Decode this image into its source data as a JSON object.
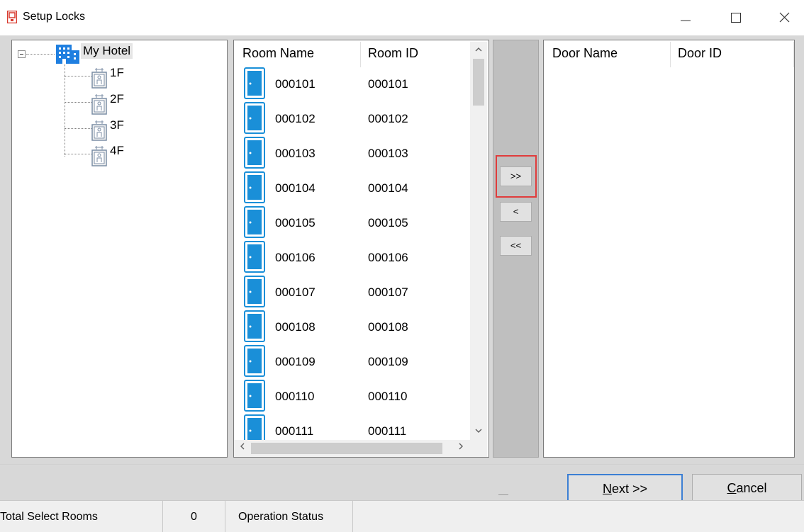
{
  "window": {
    "title": "Setup Locks",
    "controls": {
      "minimize": "—",
      "maximize": "☐",
      "close": "✕"
    }
  },
  "tree": {
    "root_label": "My Hotel",
    "root_icon": "hotel-building-icon",
    "floors": [
      {
        "label": "1F",
        "icon": "elevator-icon"
      },
      {
        "label": "2F",
        "icon": "elevator-icon"
      },
      {
        "label": "3F",
        "icon": "elevator-icon"
      },
      {
        "label": "4F",
        "icon": "elevator-icon"
      }
    ]
  },
  "rooms": {
    "headers": {
      "name": "Room Name",
      "id": "Room ID"
    },
    "items": [
      {
        "name": "000101",
        "id": "000101"
      },
      {
        "name": "000102",
        "id": "000102"
      },
      {
        "name": "000103",
        "id": "000103"
      },
      {
        "name": "000104",
        "id": "000104"
      },
      {
        "name": "000105",
        "id": "000105"
      },
      {
        "name": "000106",
        "id": "000106"
      },
      {
        "name": "000107",
        "id": "000107"
      },
      {
        "name": "000108",
        "id": "000108"
      },
      {
        "name": "000109",
        "id": "000109"
      },
      {
        "name": "000110",
        "id": "000110"
      },
      {
        "name": "000111",
        "id": "000111"
      }
    ],
    "scroll": {
      "up": "^",
      "down": "v",
      "left": "<",
      "right": ">"
    }
  },
  "transfer": {
    "add_all": ">>",
    "remove": "<",
    "remove_all": "<<"
  },
  "doors": {
    "headers": {
      "name": "Door Name",
      "id": "Door ID"
    }
  },
  "buttons": {
    "next": "Next >>",
    "cancel": "Cancel"
  },
  "status": {
    "total_label": "Total Select Rooms",
    "total_value": "0",
    "operation_label": "Operation Status"
  },
  "colors": {
    "room_icon": "#1a8fd8",
    "highlight": "#e03c3c",
    "focus": "#3c7fd4"
  }
}
